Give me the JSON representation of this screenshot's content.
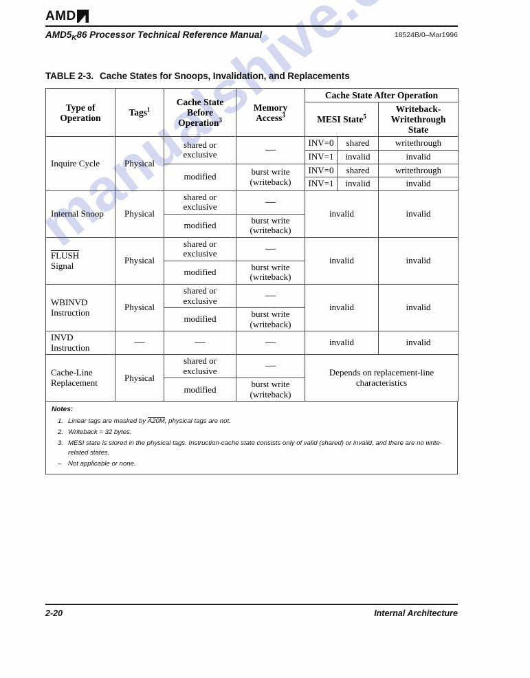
{
  "header": {
    "logo_text": "AMD",
    "logo_icon": "amd-arrow-mark",
    "manual_title_pre": "AMD5",
    "manual_title_sub": "K",
    "manual_title_post": "86 Processor Technical Reference Manual",
    "doc_id": "18524B/0–Mar1996"
  },
  "watermark": {
    "text": "manualshive.com",
    "color": "#7882d7"
  },
  "caption": {
    "label": "TABLE 2-3.",
    "title": "Cache States for Snoops, Invalidation, and Replacements"
  },
  "table": {
    "headers": {
      "type_of_operation": "Type of Operation",
      "tags": "Tags",
      "tags_note": "1",
      "cache_state_before": "Cache State Before Operation",
      "cache_state_before_note": "3",
      "memory_access": "Memory Access",
      "memory_access_note": "3",
      "cache_state_after": "Cache State After Operation",
      "mesi_state": "MESI State",
      "mesi_state_note": "5",
      "writeback_writethrough": "Writeback-Writethrough State"
    },
    "rows": [
      {
        "operation": "Inquire Cycle",
        "tags": "Physical",
        "sub": [
          {
            "before": "shared or exclusive",
            "memory": "—",
            "mesi": [
              {
                "inv": "INV=0",
                "state": "shared",
                "wbwt": "writethrough"
              },
              {
                "inv": "INV=1",
                "state": "invalid",
                "wbwt": "invalid"
              }
            ]
          },
          {
            "before": "modified",
            "memory": "burst write (writeback)",
            "mesi": [
              {
                "inv": "INV=0",
                "state": "shared",
                "wbwt": "writethrough"
              },
              {
                "inv": "INV=1",
                "state": "invalid",
                "wbwt": "invalid"
              }
            ]
          }
        ]
      },
      {
        "operation": "Internal Snoop",
        "tags": "Physical",
        "mesi_merged": "invalid",
        "wbwt_merged": "invalid",
        "sub": [
          {
            "before": "shared or exclusive",
            "memory": "—"
          },
          {
            "before": "modified",
            "memory": "burst write (writeback)"
          }
        ]
      },
      {
        "operation_overline": "FLUSH",
        "operation_rest": "Signal",
        "tags": "Physical",
        "mesi_merged": "invalid",
        "wbwt_merged": "invalid",
        "sub": [
          {
            "before": "shared or exclusive",
            "memory": "—"
          },
          {
            "before": "modified",
            "memory": "burst write (writeback)"
          }
        ]
      },
      {
        "operation": "WBINVD Instruction",
        "tags": "Physical",
        "mesi_merged": "invalid",
        "wbwt_merged": "invalid",
        "sub": [
          {
            "before": "shared or exclusive",
            "memory": "—"
          },
          {
            "before": "modified",
            "memory": "burst write (writeback)"
          }
        ]
      },
      {
        "operation": "INVD Instruction",
        "tags": "—",
        "mesi_merged": "invalid",
        "wbwt_merged": "invalid",
        "single": {
          "before": "—",
          "memory": "—"
        }
      },
      {
        "operation": "Cache-Line Replacement",
        "tags": "Physical",
        "after_merged": "Depends on replacement-line characteristics",
        "sub": [
          {
            "before": "shared or exclusive",
            "memory": "—"
          },
          {
            "before": "modified",
            "memory": "burst write (writeback)"
          }
        ]
      }
    ]
  },
  "notes": {
    "heading": "Notes:",
    "items": [
      {
        "num": "1.",
        "pre": "Linear tags are masked by ",
        "overline": "A20M",
        "post": ", physical tags are not."
      },
      {
        "num": "2.",
        "text": "Writeback = 32 bytes."
      },
      {
        "num": "3.",
        "text": "MESI state is stored in the physical tags. Instruction-cache state consists only of valid (shared) or invalid, and there are no write-related states."
      },
      {
        "num": "–",
        "text": "Not applicable or none."
      }
    ]
  },
  "footer": {
    "page_number": "2-20",
    "section": "Internal Architecture"
  }
}
